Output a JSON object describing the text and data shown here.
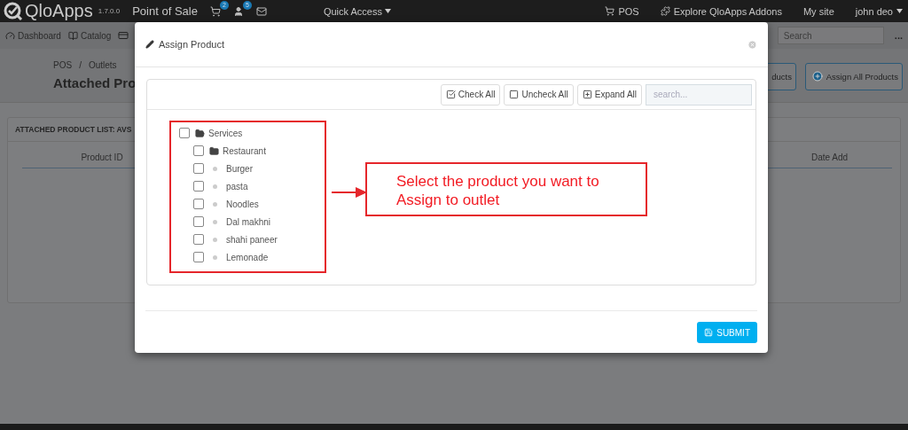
{
  "topbar": {
    "logo": "QloApps",
    "version": "1.7.0.0",
    "title": "Point of Sale",
    "cart_count": "2",
    "customer_count": "5",
    "quick_access": "Quick Access",
    "links": [
      {
        "label": "POS",
        "kind": "cart"
      },
      {
        "label": "Explore QloApps Addons",
        "kind": "addons"
      },
      {
        "label": "My site",
        "kind": "plain"
      }
    ],
    "user": "john deo"
  },
  "nav": {
    "items": [
      {
        "label": "Dashboard",
        "kind": "dashboard"
      },
      {
        "label": "Catalog",
        "kind": "catalog"
      }
    ],
    "search": {
      "placeholder": "Search"
    },
    "more": "..."
  },
  "page": {
    "breadcrumbs": [
      "POS",
      "Outlets"
    ],
    "breadcrumb_separator": "/",
    "title": "Attached Pro",
    "buttons": [
      {
        "label": "ducts",
        "kind": "plain"
      },
      {
        "label": "Assign All Products",
        "kind": "add"
      }
    ]
  },
  "panel": {
    "heading": "ATTACHED PRODUCT LIST: AVS",
    "columns": [
      "Product ID",
      "Date Add"
    ]
  },
  "modal": {
    "title": "Assign Product",
    "toolbar": [
      {
        "label": "Check All",
        "kind": "check"
      },
      {
        "label": "Uncheck All",
        "kind": "uncheck"
      },
      {
        "label": "Expand All",
        "kind": "expand"
      }
    ],
    "search": {
      "placeholder": "search..."
    },
    "tree": [
      {
        "label": "Services",
        "kind": "folder",
        "checked": false,
        "expanded": true,
        "children": [
          {
            "label": "Restaurant",
            "kind": "folder",
            "checked": false,
            "expanded": false
          },
          {
            "label": "Burger",
            "kind": "product",
            "checked": false
          },
          {
            "label": "pasta",
            "kind": "product",
            "checked": false
          },
          {
            "label": "Noodles",
            "kind": "product",
            "checked": false
          },
          {
            "label": "Dal makhni",
            "kind": "product",
            "checked": false
          },
          {
            "label": "shahi paneer",
            "kind": "product",
            "checked": false
          },
          {
            "label": "Lemonade",
            "kind": "product",
            "checked": false
          }
        ]
      }
    ],
    "annotation": "Select the product you want to Assign to outlet",
    "submit": "SUBMIT"
  }
}
